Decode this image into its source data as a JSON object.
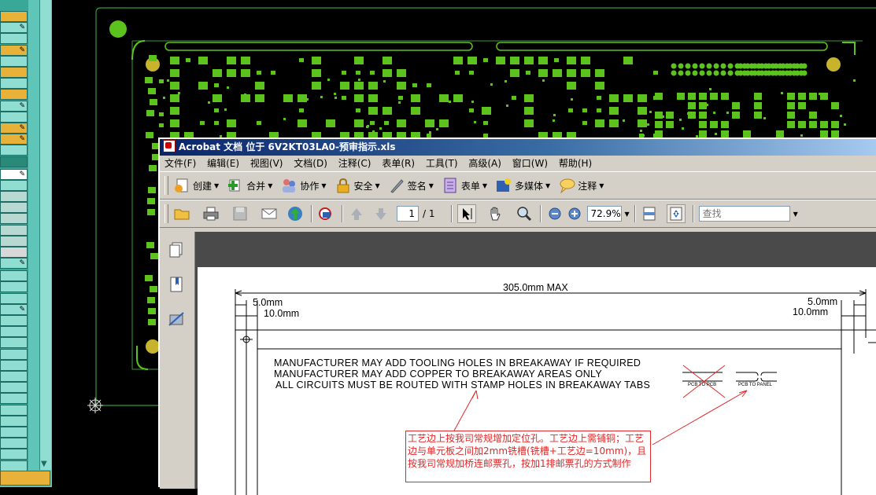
{
  "acrobat": {
    "title": "Acrobat 文档 位于 6V2KT03LA0-预审指示.xls",
    "menu": [
      "文件(F)",
      "编辑(E)",
      "视图(V)",
      "文档(D)",
      "注释(C)",
      "表单(R)",
      "工具(T)",
      "高级(A)",
      "窗口(W)",
      "帮助(H)"
    ],
    "toolbar1": {
      "create": "创建",
      "combine": "合并",
      "collaborate": "协作",
      "secure": "安全",
      "sign": "签名",
      "forms": "表单",
      "multimedia": "多媒体",
      "comment": "注释"
    },
    "toolbar2": {
      "page_current": "1",
      "page_total": "/ 1",
      "zoom": "72.9%",
      "search_placeholder": "查找"
    }
  },
  "drawing": {
    "overall_width": "305.0mm MAX",
    "dim_left_5": "5.0mm",
    "dim_left_10": "10.0mm",
    "dim_right_5": "5.0mm",
    "dim_right_10": "10.0mm",
    "notes": [
      "MANUFACTURER MAY ADD TOOLING HOLES IN BREAKAWAY IF REQUIRED",
      "MANUFACTURER MAY ADD COPPER TO BREAKAWAY AREAS ONLY",
      "ALL CIRCUITS MUST BE ROUTED WITH STAMP HOLES IN BREAKAWAY TABS"
    ],
    "pcb_to_pcb": "PCB TO PCB",
    "pcb_to_panel": "PCB TO PANEL",
    "callout": "工艺边上按我司常规增加定位孔。工艺边上需铺铜；工艺边与单元板之间加2mm铣槽(铣槽+工艺边=10mm)，且按我司常规加桥连邮票孔，按加1排邮票孔的方式制作"
  },
  "colors": {
    "pcb_green": "#5cc31e",
    "pcb_outline": "#3a9a3a",
    "callout_red": "#e0282a",
    "title_blue": "#0a246a"
  }
}
